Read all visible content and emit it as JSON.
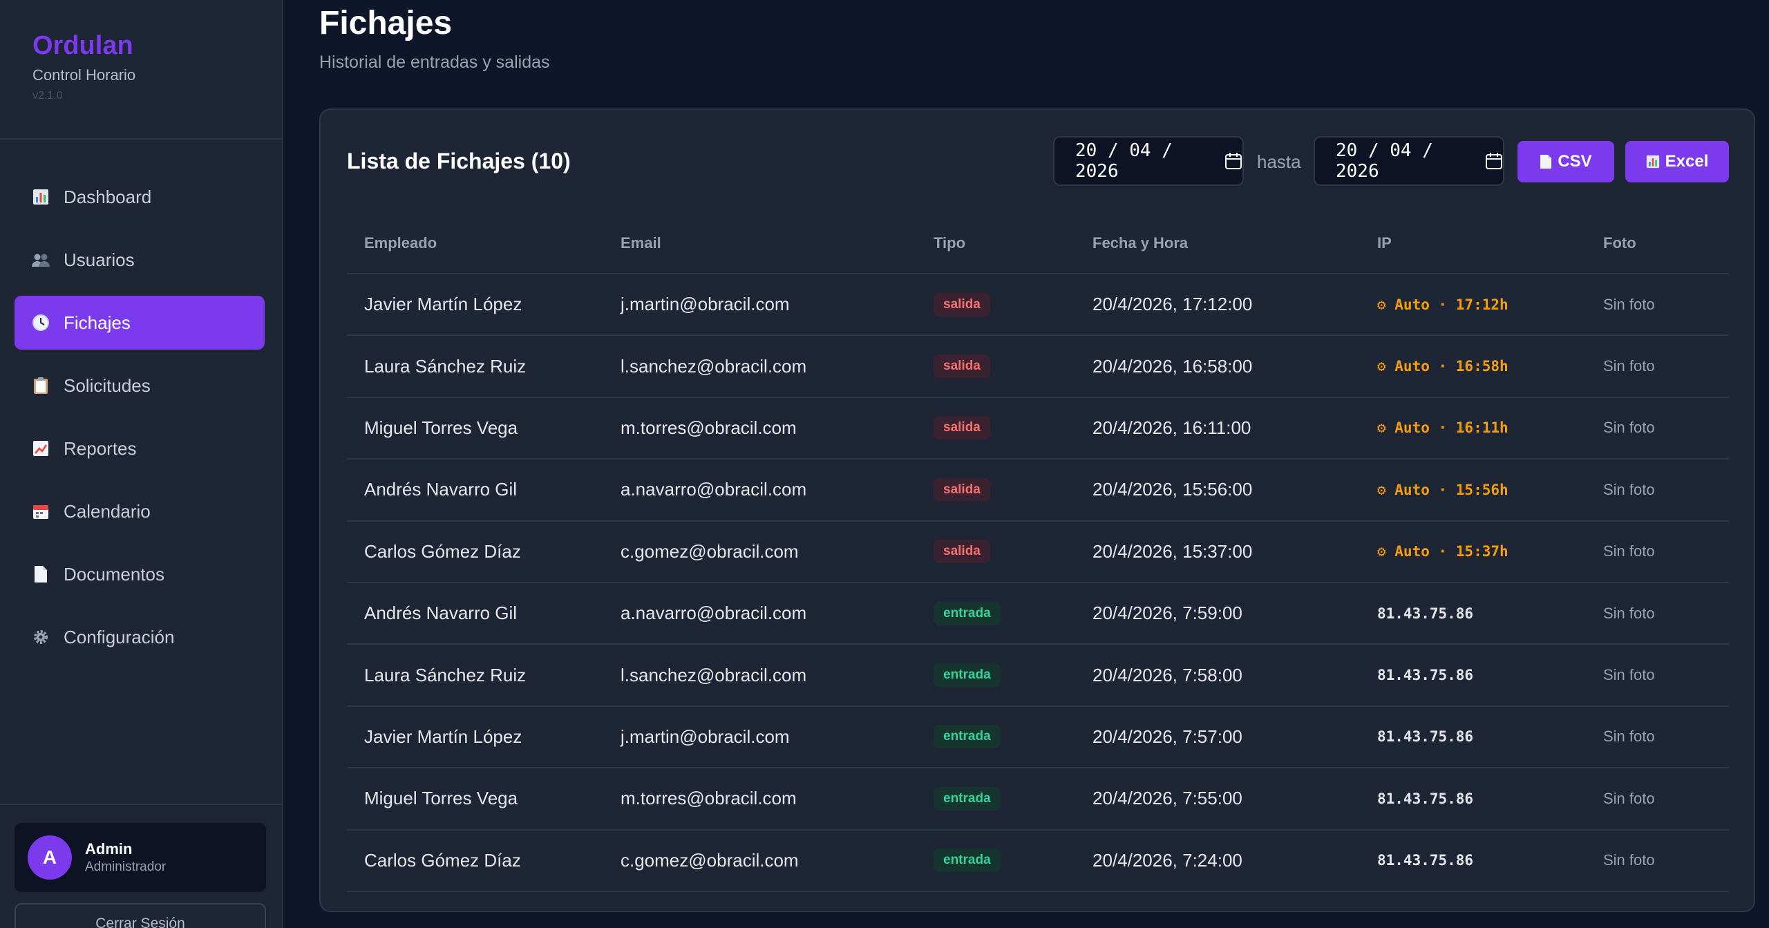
{
  "brand": {
    "name": "Ordulan",
    "subtitle": "Control Horario",
    "version": "v2.1.0"
  },
  "nav": [
    {
      "label": "Dashboard",
      "icon": "bar-chart-icon"
    },
    {
      "label": "Usuarios",
      "icon": "users-icon"
    },
    {
      "label": "Fichajes",
      "icon": "clock-icon",
      "active": true
    },
    {
      "label": "Solicitudes",
      "icon": "clipboard-icon"
    },
    {
      "label": "Reportes",
      "icon": "trend-chart-icon"
    },
    {
      "label": "Calendario",
      "icon": "calendar-icon"
    },
    {
      "label": "Documentos",
      "icon": "document-icon"
    },
    {
      "label": "Configuración",
      "icon": "gear-icon"
    }
  ],
  "user": {
    "initial": "A",
    "name": "Admin",
    "role": "Administrador",
    "logout": "Cerrar Sesión"
  },
  "page": {
    "title": "Fichajes",
    "subtitle": "Historial de entradas y salidas"
  },
  "card": {
    "title": "Lista de Fichajes (10)",
    "date_from": "20 / 04 / 2026",
    "hasta": "hasta",
    "date_to": "20 / 04 / 2026",
    "csv_label": "CSV",
    "excel_label": "Excel"
  },
  "colors": {
    "accent": "#7c3aed",
    "salida": "#f87171",
    "entrada": "#34d399",
    "auto": "#f59e0b"
  },
  "table": {
    "headers": [
      "Empleado",
      "Email",
      "Tipo",
      "Fecha y Hora",
      "IP",
      "Foto"
    ],
    "rows": [
      {
        "empleado": "Javier Martín López",
        "email": "j.martin@obracil.com",
        "tipo": "salida",
        "fecha": "20/4/2026, 17:12:00",
        "ip": "⚙ Auto · 17:12h",
        "auto": true,
        "foto": "Sin foto"
      },
      {
        "empleado": "Laura Sánchez Ruiz",
        "email": "l.sanchez@obracil.com",
        "tipo": "salida",
        "fecha": "20/4/2026, 16:58:00",
        "ip": "⚙ Auto · 16:58h",
        "auto": true,
        "foto": "Sin foto"
      },
      {
        "empleado": "Miguel Torres Vega",
        "email": "m.torres@obracil.com",
        "tipo": "salida",
        "fecha": "20/4/2026, 16:11:00",
        "ip": "⚙ Auto · 16:11h",
        "auto": true,
        "foto": "Sin foto"
      },
      {
        "empleado": "Andrés Navarro Gil",
        "email": "a.navarro@obracil.com",
        "tipo": "salida",
        "fecha": "20/4/2026, 15:56:00",
        "ip": "⚙ Auto · 15:56h",
        "auto": true,
        "foto": "Sin foto"
      },
      {
        "empleado": "Carlos Gómez Díaz",
        "email": "c.gomez@obracil.com",
        "tipo": "salida",
        "fecha": "20/4/2026, 15:37:00",
        "ip": "⚙ Auto · 15:37h",
        "auto": true,
        "foto": "Sin foto"
      },
      {
        "empleado": "Andrés Navarro Gil",
        "email": "a.navarro@obracil.com",
        "tipo": "entrada",
        "fecha": "20/4/2026, 7:59:00",
        "ip": "81.43.75.86",
        "auto": false,
        "foto": "Sin foto"
      },
      {
        "empleado": "Laura Sánchez Ruiz",
        "email": "l.sanchez@obracil.com",
        "tipo": "entrada",
        "fecha": "20/4/2026, 7:58:00",
        "ip": "81.43.75.86",
        "auto": false,
        "foto": "Sin foto"
      },
      {
        "empleado": "Javier Martín López",
        "email": "j.martin@obracil.com",
        "tipo": "entrada",
        "fecha": "20/4/2026, 7:57:00",
        "ip": "81.43.75.86",
        "auto": false,
        "foto": "Sin foto"
      },
      {
        "empleado": "Miguel Torres Vega",
        "email": "m.torres@obracil.com",
        "tipo": "entrada",
        "fecha": "20/4/2026, 7:55:00",
        "ip": "81.43.75.86",
        "auto": false,
        "foto": "Sin foto"
      },
      {
        "empleado": "Carlos Gómez Díaz",
        "email": "c.gomez@obracil.com",
        "tipo": "entrada",
        "fecha": "20/4/2026, 7:24:00",
        "ip": "81.43.75.86",
        "auto": false,
        "foto": "Sin foto"
      }
    ]
  }
}
